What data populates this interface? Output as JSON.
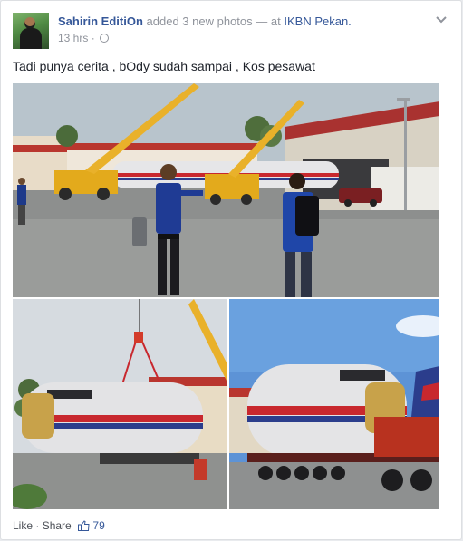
{
  "post": {
    "author": "Sahirin EditiOn",
    "action": "added 3 new photos",
    "separator": "— at",
    "location": "IKBN Pekan.",
    "timestamp": "13 hrs",
    "dot": "·",
    "privacy_icon": "globe-icon",
    "menu_icon": "chevron-down-icon",
    "message": "Tadi punya cerita , bOdy sudah sampai , Kos pesawat"
  },
  "photos": [
    {
      "icon": "photo-cranes-hangar"
    },
    {
      "icon": "photo-fuselage-lifted"
    },
    {
      "icon": "photo-fuselage-on-trailer"
    }
  ],
  "footer": {
    "like_label": "Like",
    "dot": "·",
    "share_label": "Share",
    "like_icon": "thumbs-up-icon",
    "like_count": "79"
  },
  "colors": {
    "link_blue": "#365899",
    "meta_gray": "#90949c",
    "crane_yellow": "#e9b12a",
    "livery_red": "#c8282e",
    "livery_blue": "#2b3d8c"
  }
}
